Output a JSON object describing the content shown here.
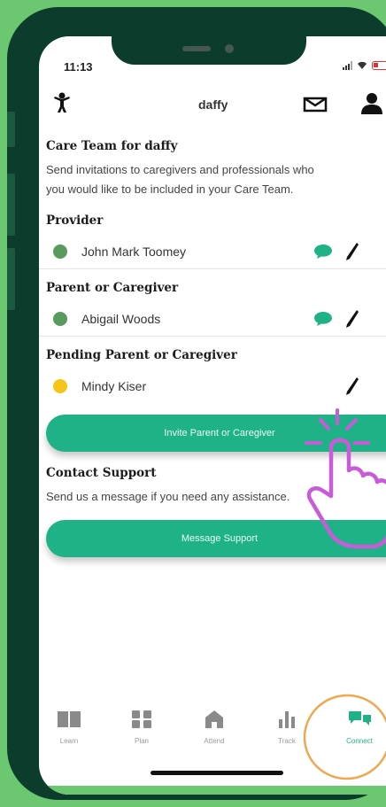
{
  "status_bar": {
    "time": "11:13"
  },
  "header": {
    "title": "daffy"
  },
  "care_team": {
    "heading": "Care Team for daffy",
    "description_lines": [
      "Send invitations to caregivers and professionals who",
      "you would like to be included in your Care Team."
    ]
  },
  "sections": {
    "provider": {
      "heading": "Provider",
      "name": "John Mark Toomey",
      "status_color": "#5a9a5e"
    },
    "parent": {
      "heading": "Parent or Caregiver",
      "name": "Abigail Woods",
      "status_color": "#5a9a5e"
    },
    "pending": {
      "heading": "Pending Parent or Caregiver",
      "name": "Mindy Kiser",
      "status_color": "#f5c518"
    }
  },
  "invite_button": {
    "label": "Invite Parent or Caregiver"
  },
  "support": {
    "heading": "Contact Support",
    "description": "Send us a message if you need any assistance.",
    "button_label": "Message Support"
  },
  "tabs": [
    {
      "label": "Learn",
      "icon": "book-icon"
    },
    {
      "label": "Plan",
      "icon": "grid-icon"
    },
    {
      "label": "Attend",
      "icon": "building-icon"
    },
    {
      "label": "Track",
      "icon": "bar-chart-icon"
    },
    {
      "label": "Connect",
      "icon": "chat-icon",
      "active": true
    }
  ],
  "colors": {
    "accent": "#1fb286",
    "background": "#6cc870",
    "frame": "#0c3d2c",
    "annotation": "#c85bd8",
    "circle": "#f0a850"
  }
}
